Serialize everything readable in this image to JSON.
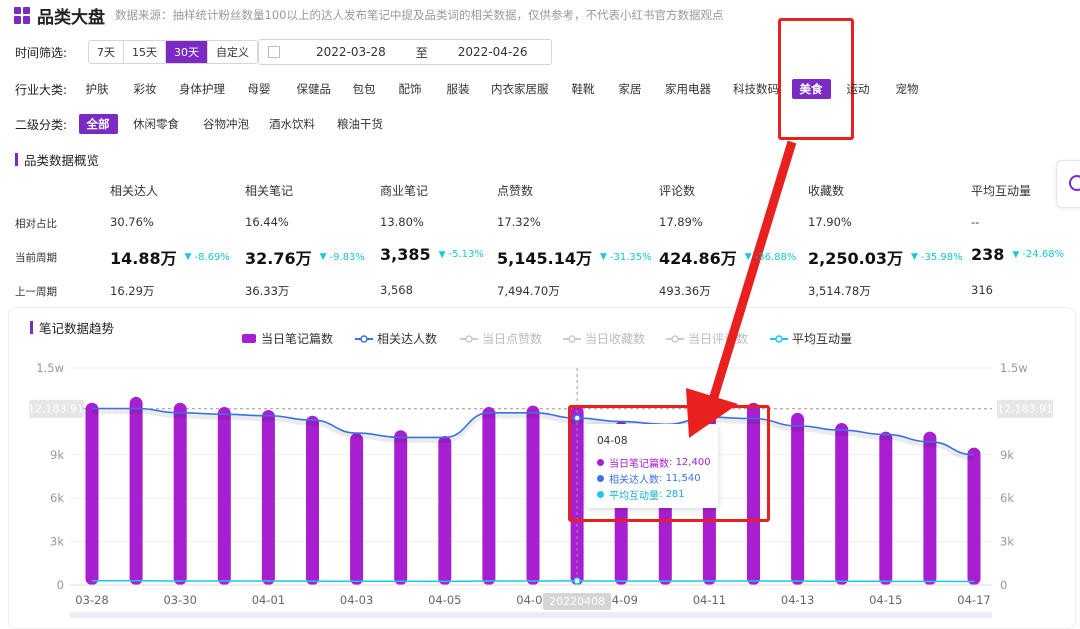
{
  "header": {
    "title": "品类大盘",
    "subtitle": "数据来源：抽样统计粉丝数量100以上的达人发布笔记中提及品类词的相关数据，仅供参考，不代表小红书官方数据观点"
  },
  "time_filter": {
    "label": "时间筛选:",
    "options": [
      "7天",
      "15天",
      "30天",
      "自定义"
    ],
    "active": "30天",
    "start_date": "2022-03-28",
    "separator": "至",
    "end_date": "2022-04-26"
  },
  "industry": {
    "label": "行业大类:",
    "items": [
      "护肤",
      "彩妆",
      "身体护理",
      "母婴",
      "保健品",
      "包包",
      "配饰",
      "服装",
      "内衣家居服",
      "鞋靴",
      "家居",
      "家用电器",
      "科技数码",
      "美食",
      "运动",
      "宠物"
    ],
    "active": "美食"
  },
  "sub_category": {
    "label": "二级分类:",
    "items": [
      "全部",
      "休闲零食",
      "谷物冲泡",
      "酒水饮料",
      "粮油干货"
    ],
    "active": "全部"
  },
  "overview": {
    "title": "品类数据概览",
    "row_labels": [
      "相对占比",
      "当前周期",
      "上一周期"
    ],
    "columns": [
      {
        "header": "相关达人",
        "ratio": "30.76%",
        "current": "14.88万",
        "change": "-8.69%",
        "previous": "16.29万"
      },
      {
        "header": "相关笔记",
        "ratio": "16.44%",
        "current": "32.76万",
        "change": "-9.83%",
        "previous": "36.33万"
      },
      {
        "header": "商业笔记",
        "ratio": "13.80%",
        "current": "3,385",
        "change": "-5.13%",
        "previous": "3,568"
      },
      {
        "header": "点赞数",
        "ratio": "17.32%",
        "current": "5,145.14万",
        "change": "-31.35%",
        "previous": "7,494.70万"
      },
      {
        "header": "评论数",
        "ratio": "17.89%",
        "current": "424.86万",
        "change": "-36.88%",
        "previous": "493.36万"
      },
      {
        "header": "收藏数",
        "ratio": "17.90%",
        "current": "2,250.03万",
        "change": "-35.98%",
        "previous": "3,514.78万"
      },
      {
        "header": "平均互动量",
        "ratio": "--",
        "current": "238",
        "change": "-24.68%",
        "previous": "316"
      }
    ]
  },
  "trend": {
    "title": "笔记数据趋势",
    "legend": [
      "当日笔记篇数",
      "相关达人数",
      "当日点赞数",
      "当日收藏数",
      "当日评论数",
      "平均互动量"
    ],
    "colors": {
      "purple": "#a71fd0",
      "blue": "#3a72e6",
      "cyan": "#1cc7e6",
      "accent": "#7b2ac3",
      "annotation": "#e8201f"
    },
    "ref_value": "12,183.91",
    "crosshair_label": "20220408",
    "tooltip": {
      "date": "04-08",
      "rows": [
        {
          "name": "当日笔记篇数",
          "value": "12,400"
        },
        {
          "name": "相关达人数",
          "value": "11,540"
        },
        {
          "name": "平均互动量",
          "value": "281"
        }
      ]
    }
  },
  "chart_data": {
    "type": "bar",
    "title": "笔记数据趋势",
    "categories": [
      "03-28",
      "03-29",
      "03-30",
      "03-31",
      "04-01",
      "04-02",
      "04-03",
      "04-04",
      "04-05",
      "04-06",
      "04-07",
      "04-08",
      "04-09",
      "04-10",
      "04-11",
      "04-12",
      "04-13",
      "04-14",
      "04-15",
      "04-16",
      "04-17"
    ],
    "x_tick_labels": [
      "03-28",
      "03-30",
      "04-01",
      "04-03",
      "04-05",
      "04-07",
      "04-09",
      "04-11",
      "04-13",
      "04-15",
      "04-17"
    ],
    "y_tick_labels": [
      "0",
      "3k",
      "6k",
      "9k",
      "1.5w"
    ],
    "ylim": [
      0,
      15000
    ],
    "series": [
      {
        "name": "当日笔记篇数",
        "type": "bar",
        "color": "#a71fd0",
        "values": [
          12600,
          13000,
          12600,
          12300,
          12100,
          11700,
          10500,
          10700,
          10300,
          12300,
          12400,
          12400,
          11300,
          10900,
          11900,
          12600,
          11900,
          11200,
          10600,
          10600,
          9500
        ]
      },
      {
        "name": "相关达人数",
        "type": "line",
        "color": "#3a72e6",
        "values": [
          12200,
          12200,
          11900,
          11800,
          11700,
          11400,
          10500,
          10200,
          10200,
          11900,
          11900,
          11540,
          11300,
          11100,
          11600,
          11500,
          11000,
          10700,
          10400,
          9900,
          9000
        ]
      },
      {
        "name": "平均互动量",
        "type": "line",
        "color": "#1cc7e6",
        "values": [
          290,
          290,
          280,
          280,
          280,
          270,
          260,
          255,
          250,
          280,
          280,
          281,
          270,
          265,
          280,
          275,
          265,
          260,
          255,
          250,
          240
        ]
      }
    ],
    "reference_line": 12183.91
  }
}
